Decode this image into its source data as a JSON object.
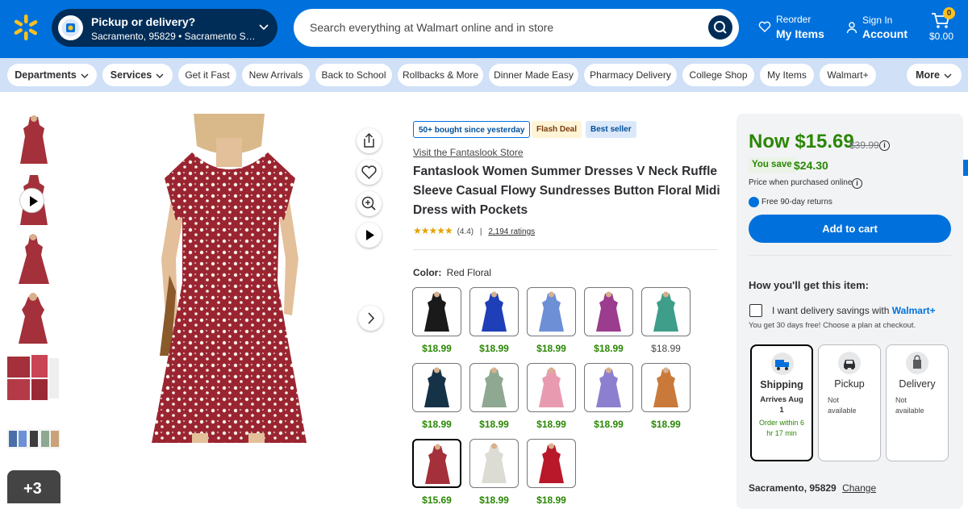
{
  "header": {
    "pickup_title": "Pickup or delivery?",
    "pickup_location": "Sacramento, 95829 • Sacramento Supercenter",
    "search_placeholder": "Search everything at Walmart online and in store",
    "reorder_small": "Reorder",
    "reorder_big": "My Items",
    "account_small": "Sign In",
    "account_big": "Account",
    "cart_count": "0",
    "cart_total": "$0.00",
    "brand_color": "#0071dc"
  },
  "nav": {
    "items": [
      "Departments",
      "Services",
      "Get it Fast",
      "New Arrivals",
      "Back to School",
      "Rollbacks & More",
      "Dinner Made Easy",
      "Pharmacy Delivery",
      "College Shop",
      "My Items",
      "Walmart+",
      "More"
    ]
  },
  "gallery": {
    "more_count": "+3"
  },
  "product": {
    "badges": [
      "50+ bought since yesterday",
      "Flash Deal",
      "Best seller"
    ],
    "store_link": "Visit the Fantaslook Store",
    "title": "Fantaslook Women Summer Dresses V Neck Ruffle Sleeve Casual Flowy Sundresses Button Floral Midi Dress with Pockets",
    "stars": "★★★★★",
    "rating_value": "(4.4)",
    "separator": "|",
    "ratings_count": "2,194 ratings",
    "color_label": "Color:",
    "color_value": "Red Floral",
    "swatches": [
      {
        "color": "#1a1a1a",
        "price": "$18.99"
      },
      {
        "color": "#1f3fb8",
        "price": "$18.99"
      },
      {
        "color": "#6d8fd6",
        "price": "$18.99"
      },
      {
        "color": "#9c3c8e",
        "price": "$18.99"
      },
      {
        "color": "#3e9e8a",
        "price": "$18.99"
      },
      {
        "color": "#163247",
        "price": "$18.99"
      },
      {
        "color": "#8fa891",
        "price": "$18.99"
      },
      {
        "color": "#e89bb0",
        "price": "$18.99"
      },
      {
        "color": "#8d7fcf",
        "price": "$18.99"
      },
      {
        "color": "#c97a3a",
        "price": "$18.99"
      },
      {
        "color": "#a3303a",
        "price": "$15.69"
      },
      {
        "color": "#dcdcd4",
        "price": "$18.99"
      },
      {
        "color": "#b8182a",
        "price": "$18.99"
      }
    ]
  },
  "buybox": {
    "now_price": "Now $15.69",
    "was_price": "$39.99",
    "you_save_label": "You save",
    "you_save_amount": "$24.30",
    "price_note": "Price when purchased online",
    "returns": "Free 90-day returns",
    "add_to_cart": "Add to cart",
    "how_get": "How you'll get this item:",
    "delivery_savings": "I want delivery savings with",
    "walmart_plus": "Walmart+",
    "free_trial": "You get 30 days free! Choose a plan at checkout.",
    "options": [
      {
        "name": "Shipping",
        "line1": "Arrives Aug",
        "line2": "1",
        "order": "Order within 6 hr 17 min"
      },
      {
        "name": "Pickup",
        "line1": "Not",
        "line2": "available"
      },
      {
        "name": "Delivery",
        "line1": "Not",
        "line2": "available"
      }
    ],
    "location": "Sacramento, 95829",
    "change": "Change"
  }
}
